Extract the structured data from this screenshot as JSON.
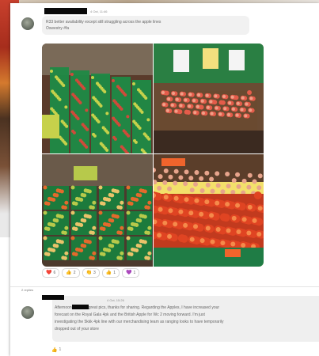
{
  "post": {
    "timestamp": "4 Oct, 11:46",
    "text_line1": "R33 better availability except still struggling across the apple lines",
    "text_line2": "Oswestry #fa"
  },
  "photos": [
    {
      "name": "produce-aisle-photo",
      "colors": [
        "#1f8a46",
        "#d04a3a",
        "#c6d14b",
        "#5a3b2b"
      ]
    },
    {
      "name": "apple-display-photo",
      "colors": [
        "#2a7f43",
        "#e45c4a",
        "#f3e07e",
        "#6a4b33"
      ]
    },
    {
      "name": "produce-crates-photo",
      "colors": [
        "#1c7a3c",
        "#e36a2c",
        "#b7c94b",
        "#4c3a2d"
      ]
    },
    {
      "name": "tomato-display-photo",
      "colors": [
        "#1f7c45",
        "#e04422",
        "#f0642c",
        "#f3e06b"
      ]
    }
  ],
  "reactions": [
    {
      "emoji": "❤️",
      "count": "6",
      "color": "#d93a3a"
    },
    {
      "emoji": "👍",
      "count": "2",
      "color": "#f2b428"
    },
    {
      "emoji": "👏",
      "count": "3",
      "color": "#f2b428"
    },
    {
      "emoji": "👍",
      "count": "1",
      "color": "#f2b428"
    },
    {
      "emoji": "💜",
      "count": "1",
      "color": "#7b4fc4"
    }
  ],
  "replies": {
    "label": "2 replies",
    "reply": {
      "timestamp": "4 Oct, 15:26",
      "line1_pre": "Afternoon",
      "line1_post": "great pics, thanks for sharing. Regarding the Apples, I have increased your",
      "line2": "forecast on the Royal Gala 4pk and the British Apple for Wc 2 moving forward. I'm just",
      "line3": "investigating the 5kkk 4pk line with our merchandising team as ranging looks to have temporarily",
      "line4": "dropped out of your store",
      "reaction_emoji": "👍",
      "reaction_count": "1"
    }
  }
}
